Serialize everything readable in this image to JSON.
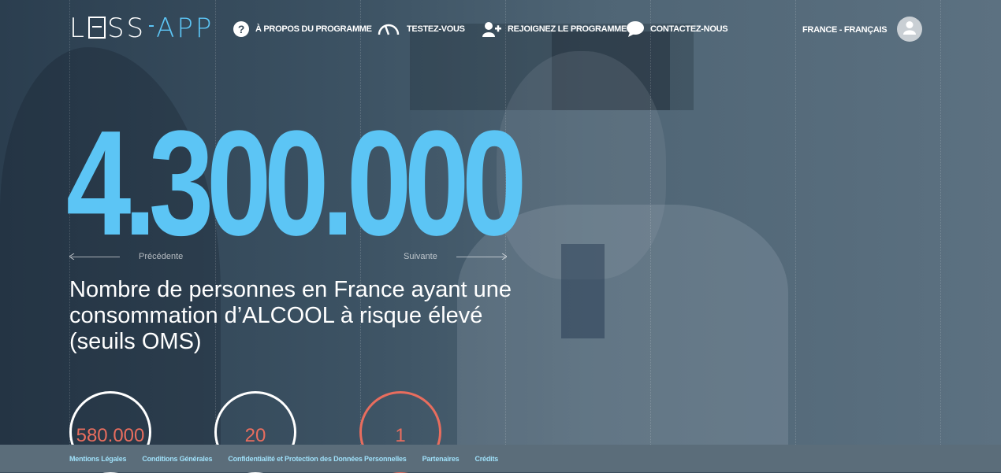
{
  "logo": {
    "part1": "L",
    "part2": "SS",
    "part3": "APP"
  },
  "nav": {
    "about": "À PROPOS DU PROGRAMME",
    "test": "TESTEZ-VOUS",
    "join": "REJOIGNEZ LE PROGRAMME",
    "contact": "CONTACTEZ-NOUS"
  },
  "language": "FRANCE - FRANÇAIS",
  "hero": {
    "number": "4.300.000",
    "prev_label": "Précédente",
    "next_label": "Suivante",
    "description": "Nombre de personnes en France ayant une consommation d’ALCOOL à risque élevé (seuils OMS)"
  },
  "stats": [
    {
      "value": "580.000"
    },
    {
      "value": "20"
    },
    {
      "value": "1"
    }
  ],
  "footer": {
    "links": [
      "Mentions Légales",
      "Conditions Générales",
      "Confidentialité et Protection des Données Personnelles",
      "Partenaires",
      "Crédits"
    ]
  },
  "colors": {
    "accent": "#5cc5f5",
    "stat_red": "#e86d5e",
    "footer_bg": "#5b6d7a",
    "footer_link": "#9fe0f9"
  }
}
